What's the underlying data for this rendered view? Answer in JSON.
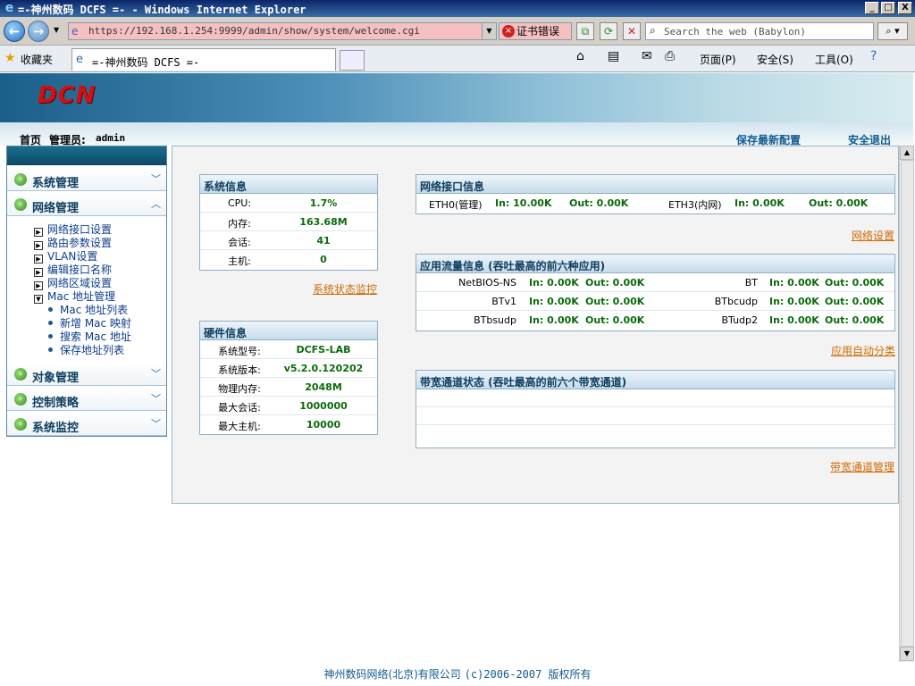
{
  "window": {
    "title": "=-神州数码 DCFS =- - Windows Internet Explorer",
    "minimize": "_",
    "maximize": "□",
    "close": "X"
  },
  "browser": {
    "url": "https://192.168.1.254:9999/admin/show/system/welcome.cgi",
    "cert_error": "证书错误",
    "search_placeholder": "Search the web (Babylon)",
    "favorites": "收藏夹",
    "tab_title": "=-神州数码 DCFS =-",
    "page_menu": "页面(P)",
    "safety_menu": "安全(S)",
    "tools_menu": "工具(O)"
  },
  "header": {
    "logo": "DCN",
    "home": "首页",
    "admin_label": "管理员:",
    "admin_name": "admin",
    "save_config": "保存最新配置",
    "logout": "安全退出"
  },
  "menu": {
    "system_mgmt": "系统管理",
    "network_mgmt": "网络管理",
    "net_sub": [
      "网络接口设置",
      "路由参数设置",
      "VLAN设置",
      "编辑接口名称",
      "网络区域设置",
      "Mac 地址管理"
    ],
    "mac_sub": [
      "Mac 地址列表",
      "新增 Mac 映射",
      "搜索 Mac 地址",
      "保存地址列表"
    ],
    "object_mgmt": "对象管理",
    "control_policy": "控制策略",
    "system_monitor": "系统监控"
  },
  "sysinfo": {
    "title": "系统信息",
    "rows": [
      {
        "k": "CPU:",
        "v": "1.7%"
      },
      {
        "k": "内存:",
        "v": "163.68M"
      },
      {
        "k": "会话:",
        "v": "41"
      },
      {
        "k": "主机:",
        "v": "0"
      }
    ],
    "link": "系统状态监控"
  },
  "hwinfo": {
    "title": "硬件信息",
    "rows": [
      {
        "k": "系统型号:",
        "v": "DCFS-LAB"
      },
      {
        "k": "系统版本:",
        "v": "v5.2.0.120202"
      },
      {
        "k": "物理内存:",
        "v": "2048M"
      },
      {
        "k": "最大会话:",
        "v": "1000000"
      },
      {
        "k": "最大主机:",
        "v": "10000"
      }
    ]
  },
  "netif": {
    "title": "网络接口信息",
    "if1_name": "ETH0(管理)",
    "if1_in": "In: 10.00K",
    "if1_out": "Out: 0.00K",
    "if2_name": "ETH3(内网)",
    "if2_in": "In: 0.00K",
    "if2_out": "Out: 0.00K",
    "link": "网络设置"
  },
  "apptraffic": {
    "title": "应用流量信息 (吞吐最高的前六种应用)",
    "rows": [
      {
        "a": "NetBIOS-NS",
        "ain": "In: 0.00K",
        "aout": "Out: 0.00K",
        "b": "BT",
        "bin": "In: 0.00K",
        "bout": "Out: 0.00K"
      },
      {
        "a": "BTv1",
        "ain": "In: 0.00K",
        "aout": "Out: 0.00K",
        "b": "BTbcudp",
        "bin": "In: 0.00K",
        "bout": "Out: 0.00K"
      },
      {
        "a": "BTbsudp",
        "ain": "In: 0.00K",
        "aout": "Out: 0.00K",
        "b": "BTudp2",
        "bin": "In: 0.00K",
        "bout": "Out: 0.00K"
      }
    ],
    "link": "应用自动分类"
  },
  "bandwidth": {
    "title": "带宽通道状态 (吞吐最高的前六个带宽通道)",
    "link": "带宽通道管理"
  },
  "footer": {
    "company": "神州数码网络(北京)有限公司",
    "copyright": "(c)2006-2007 版权所有"
  },
  "colors": {
    "accent": "#125b8f",
    "value_green": "#0b6b0b",
    "link_orange": "#d06a00",
    "logo_red": "#d21010"
  }
}
